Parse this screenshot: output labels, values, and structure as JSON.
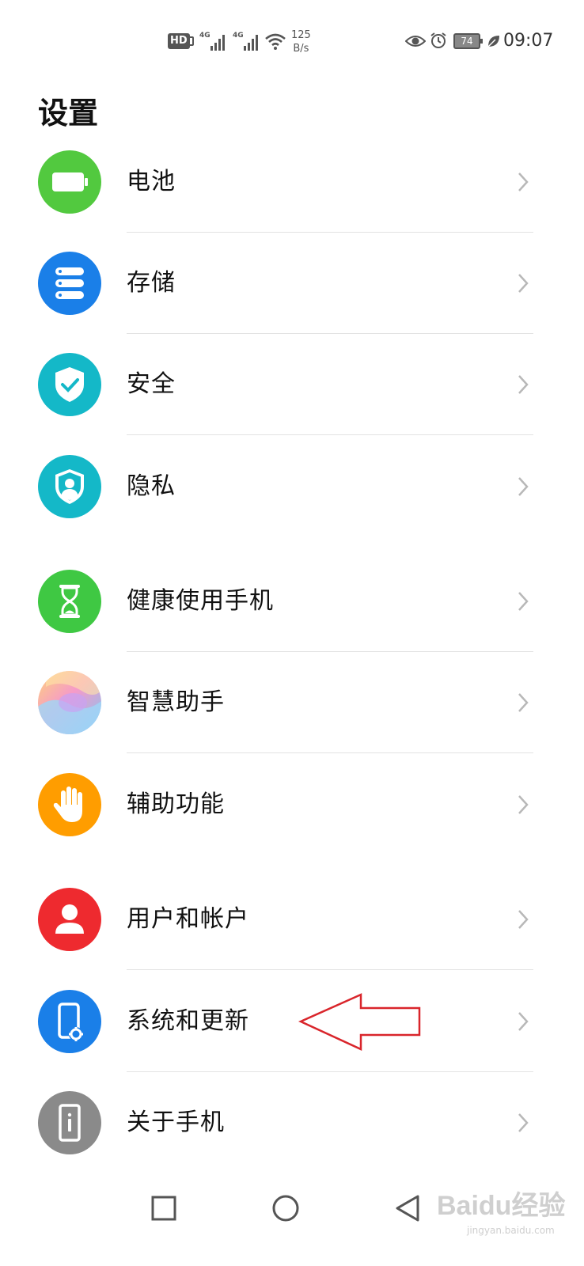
{
  "status_bar": {
    "hd": "HD",
    "sim1": "4G",
    "sim2": "4G",
    "speed_value": "125",
    "speed_unit": "B/s",
    "battery": "74",
    "time": "09:07"
  },
  "page": {
    "title": "设置"
  },
  "settings": [
    {
      "label": "电池",
      "icon": "battery-icon",
      "color": "#52c93f"
    },
    {
      "label": "存储",
      "icon": "storage-icon",
      "color": "#1a7fe8"
    },
    {
      "label": "安全",
      "icon": "security-shield-icon",
      "color": "#14b8c8"
    },
    {
      "label": "隐私",
      "icon": "privacy-icon",
      "color": "#14b8c8"
    },
    {
      "label": "健康使用手机",
      "icon": "hourglass-icon",
      "color": "#3fc843"
    },
    {
      "label": "智慧助手",
      "icon": "smart-assistant-icon",
      "color": "#c6a9f0"
    },
    {
      "label": "辅助功能",
      "icon": "hand-icon",
      "color": "#ff9d00"
    },
    {
      "label": "用户和帐户",
      "icon": "user-icon",
      "color": "#ee2a2f"
    },
    {
      "label": "系统和更新",
      "icon": "system-update-icon",
      "color": "#1a7fe8"
    },
    {
      "label": "关于手机",
      "icon": "about-phone-icon",
      "color": "#8a8a8a"
    }
  ],
  "watermark": {
    "text": "Baidu经验",
    "sub": "jingyan.baidu.com"
  }
}
